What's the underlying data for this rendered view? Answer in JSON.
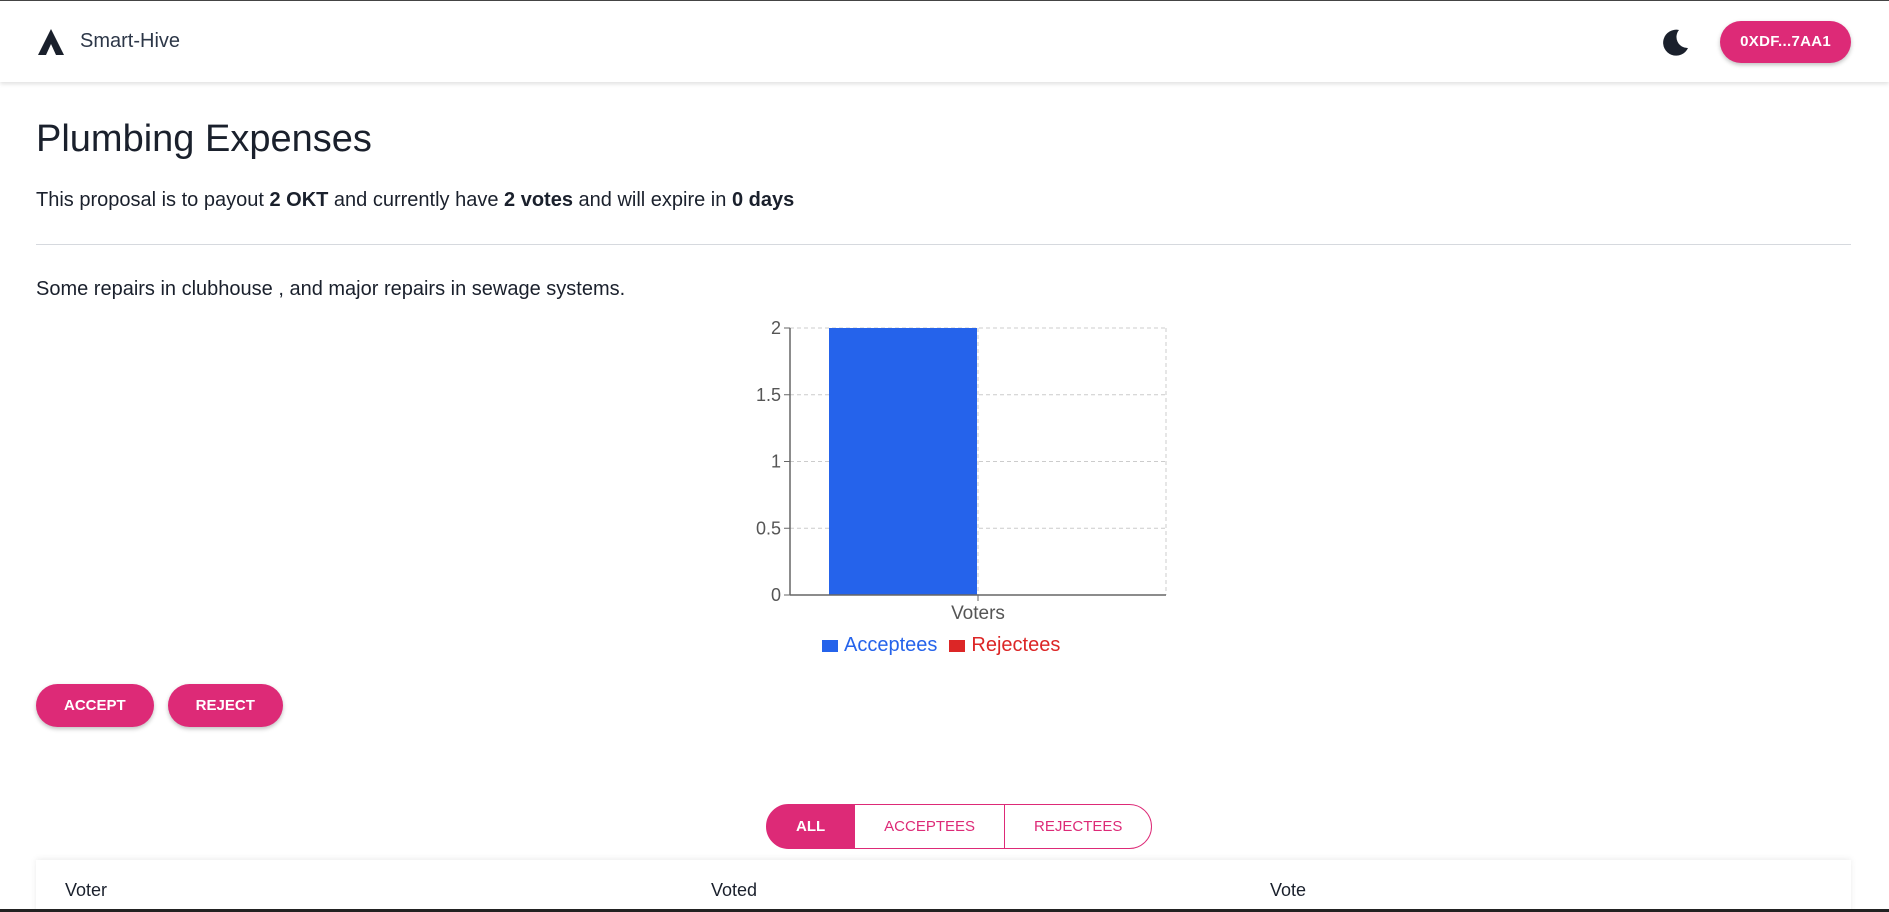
{
  "header": {
    "brand": "Smart-Hive",
    "logo_icon": "triangle-logo-icon",
    "theme_icon": "moon-icon",
    "wallet_label": "0XDF...7AA1"
  },
  "proposal": {
    "title": "Plumbing Expenses",
    "summary": {
      "prefix": "This proposal is to payout ",
      "amount": "2 OKT",
      "mid1": " and currently have ",
      "votes": "2 votes",
      "mid2": " and will expire in ",
      "expiry": "0 days"
    },
    "description": "Some repairs in clubhouse , and major repairs in sewage systems."
  },
  "chart_data": {
    "type": "bar",
    "categories": [
      "Voters"
    ],
    "series": [
      {
        "name": "Acceptees",
        "values": [
          2
        ],
        "color": "#2563eb"
      },
      {
        "name": "Rejectees",
        "values": [
          0
        ],
        "color": "#dc2626"
      }
    ],
    "xlabel": "",
    "ylabel": "",
    "ylim": [
      0,
      2
    ],
    "yticks": [
      "0",
      "0.5",
      "1",
      "1.5",
      "2"
    ],
    "grid": true,
    "legend": "bottom"
  },
  "actions": {
    "accept_label": "ACCEPT",
    "reject_label": "REJECT"
  },
  "filters": {
    "all": "ALL",
    "acceptees": "ACCEPTEES",
    "rejectees": "REJECTEES",
    "active": "ALL"
  },
  "table": {
    "columns": [
      "Voter",
      "Voted",
      "Vote"
    ]
  },
  "colors": {
    "accent": "#dd2a77",
    "accept": "#2563eb",
    "reject": "#dc2626"
  }
}
